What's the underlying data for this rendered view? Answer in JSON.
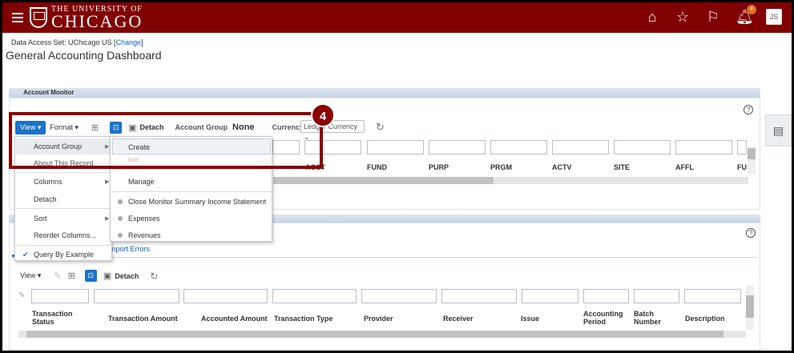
{
  "header": {
    "logo_line1": "THE UNIVERSITY OF",
    "logo_line2": "CHICAGO",
    "notification_count": "4",
    "user_initials": "JS",
    "brand_color": "#800000"
  },
  "data_access": {
    "label": "Data Access Set: UChicago US [",
    "link": "Change",
    "suffix": "]"
  },
  "page_title": "General Accounting Dashboard",
  "account_monitor": {
    "panel_title": "Account Monitor",
    "toolbar": {
      "view": "View ▾",
      "format": "Format ▾",
      "detach": "Detach",
      "account_group_label": "Account Group",
      "account_group_value": "None",
      "currency_label": "Currency",
      "currency_value": "Ledger Currency"
    },
    "columns": [
      "ACCT",
      "FUND",
      "PURP",
      "PRGM",
      "ACTV",
      "SITE",
      "AFFL",
      "FU"
    ]
  },
  "view_menu": {
    "items": [
      "Account Group",
      "About This Record",
      "Columns",
      "Detach",
      "Sort",
      "Reorder Columns...",
      "Query By Example"
    ],
    "check_mark": "✔"
  },
  "account_group_submenu": {
    "create": "Create",
    "edit": "Edit",
    "manage": "Manage",
    "groups": [
      "Close Monitor Summary Income Statement",
      "Expenses",
      "Revenues"
    ]
  },
  "callout_number": "4",
  "journals": {
    "tab_partial": "mport Errors",
    "toolbar": {
      "view": "View ▾",
      "detach": "Detach"
    },
    "columns": [
      "Transaction Status",
      "Transaction Amount",
      "Accounted Amount",
      "Transaction Type",
      "Provider",
      "Receiver",
      "Issue",
      "Accounting Period",
      "Batch Number",
      "Description"
    ]
  }
}
